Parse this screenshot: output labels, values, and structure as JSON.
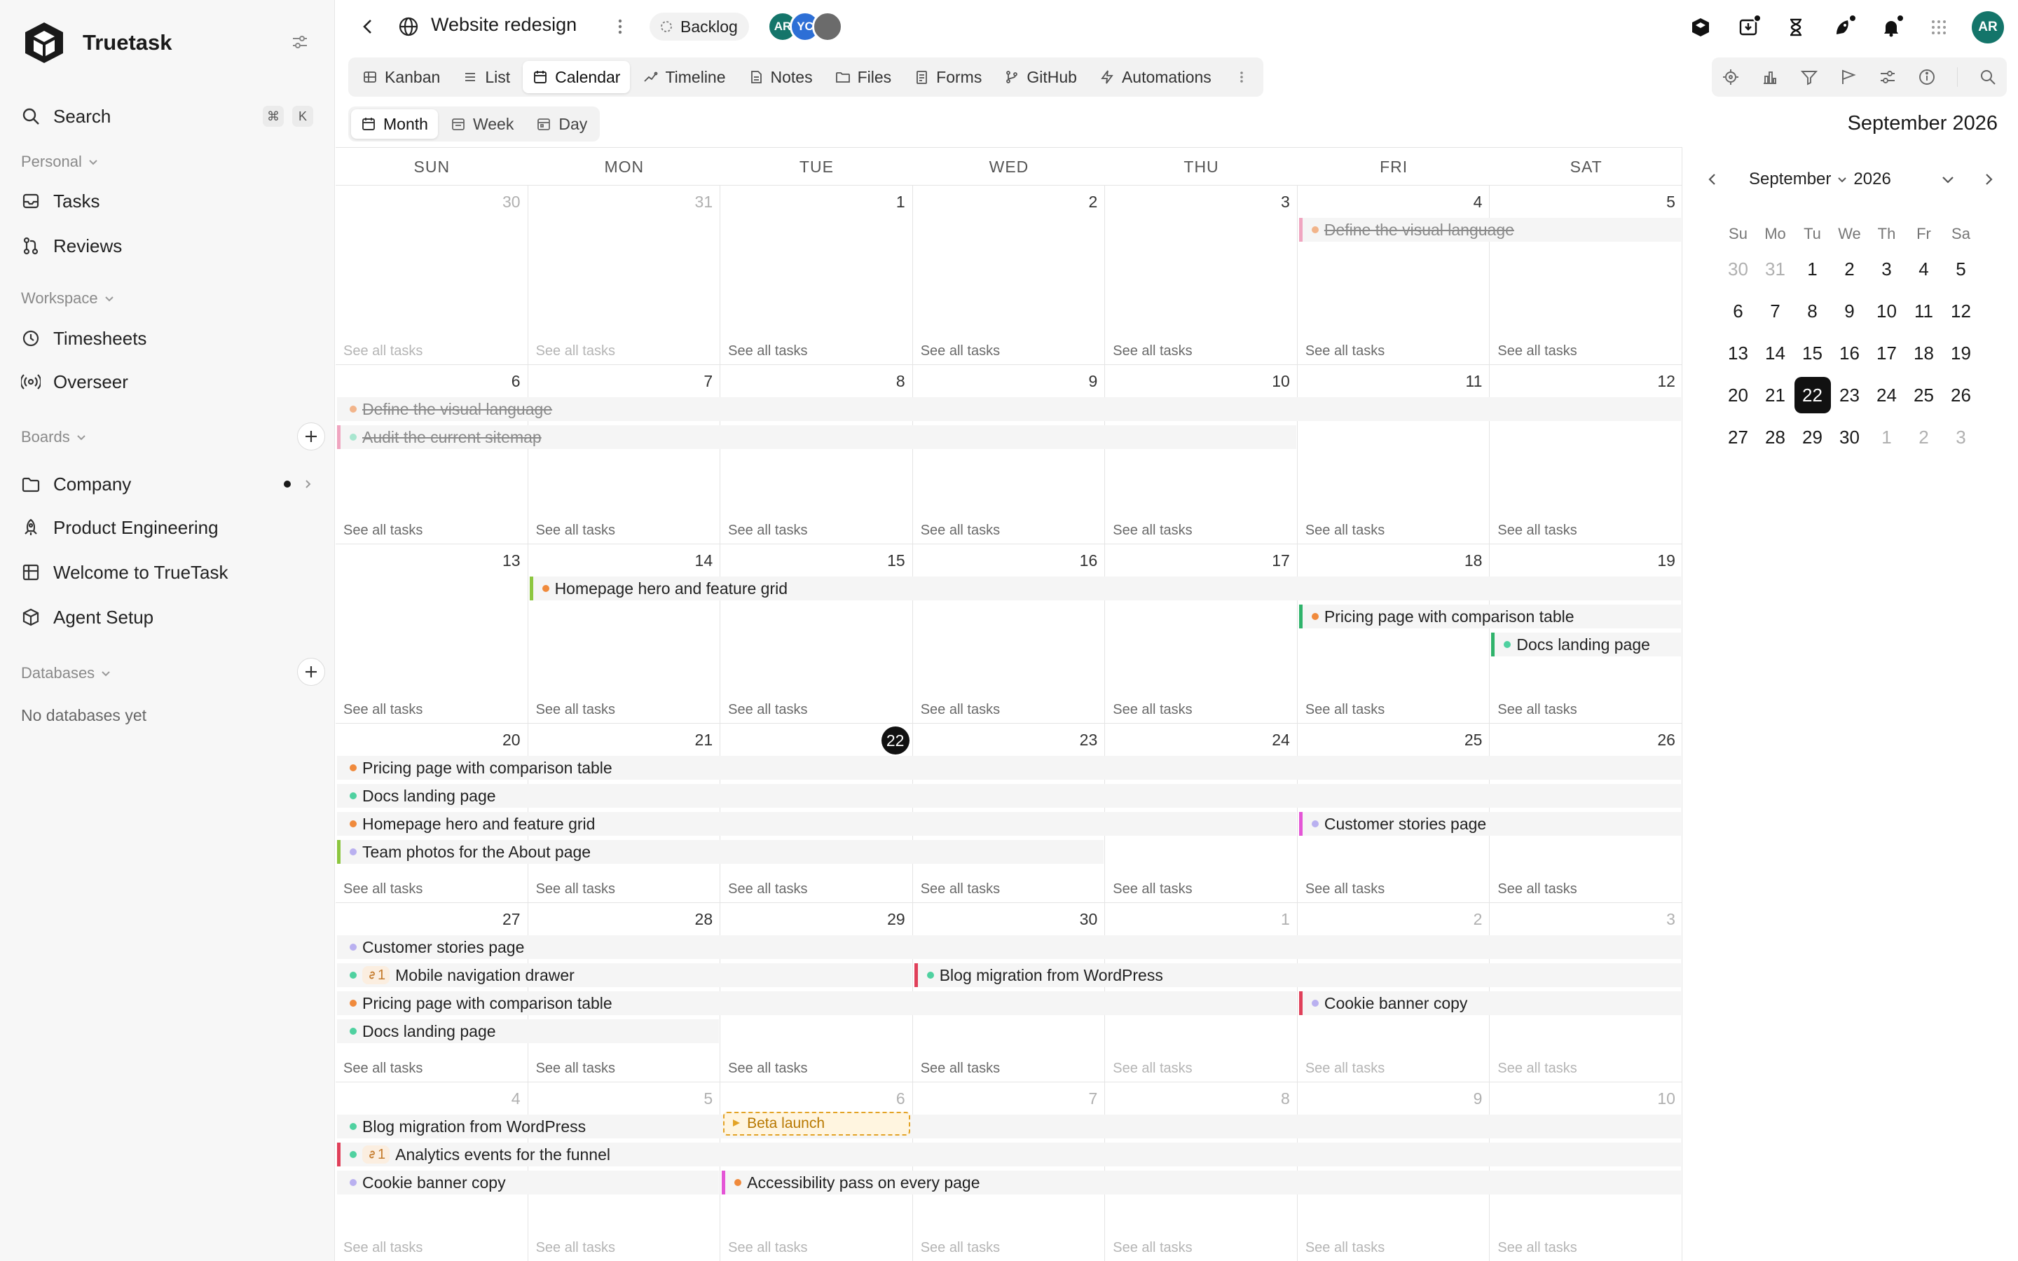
{
  "sidebar": {
    "brand": "Truetask",
    "search": {
      "label": "Search",
      "kbd1": "⌘",
      "kbd2": "K"
    },
    "personal": {
      "label": "Personal",
      "items": [
        {
          "label": "Tasks"
        },
        {
          "label": "Reviews"
        }
      ]
    },
    "workspace": {
      "label": "Workspace",
      "items": [
        {
          "label": "Timesheets"
        },
        {
          "label": "Overseer"
        }
      ]
    },
    "boards": {
      "label": "Boards",
      "items": [
        {
          "label": "Company"
        },
        {
          "label": "Product Engineering"
        },
        {
          "label": "Welcome to TrueTask"
        },
        {
          "label": "Agent Setup"
        }
      ]
    },
    "databases": {
      "label": "Databases",
      "empty": "No databases yet"
    }
  },
  "header": {
    "title": "Website redesign",
    "status": "Backlog",
    "avatars": [
      {
        "initials": "AR",
        "color": "#14756a"
      },
      {
        "initials": "YC",
        "color": "#2d6fd6"
      },
      {
        "initials": "",
        "color": "#6b6b6b"
      }
    ],
    "user_initials": "AR"
  },
  "views": [
    {
      "label": "Kanban",
      "icon": "kanban-icon",
      "active": false
    },
    {
      "label": "List",
      "icon": "list-icon",
      "active": false
    },
    {
      "label": "Calendar",
      "icon": "calendar-icon",
      "active": true
    },
    {
      "label": "Timeline",
      "icon": "timeline-icon",
      "active": false
    },
    {
      "label": "Notes",
      "icon": "notes-icon",
      "active": false
    },
    {
      "label": "Files",
      "icon": "folder-icon",
      "active": false
    },
    {
      "label": "Forms",
      "icon": "forms-icon",
      "active": false
    },
    {
      "label": "GitHub",
      "icon": "git-branch-icon",
      "active": false
    },
    {
      "label": "Automations",
      "icon": "bolt-icon",
      "active": false
    }
  ],
  "ranges": [
    {
      "label": "Month",
      "active": true
    },
    {
      "label": "Week",
      "active": false
    },
    {
      "label": "Day",
      "active": false
    }
  ],
  "calendar": {
    "title": "September 2026",
    "weekdays": [
      "SUN",
      "MON",
      "TUE",
      "WED",
      "THU",
      "FRI",
      "SAT"
    ],
    "see_all": "See all tasks",
    "weeks": [
      {
        "days": [
          {
            "n": "30",
            "m": true
          },
          {
            "n": "31",
            "m": true
          },
          {
            "n": "1"
          },
          {
            "n": "2"
          },
          {
            "n": "3"
          },
          {
            "n": "4"
          },
          {
            "n": "5"
          }
        ]
      },
      {
        "days": [
          {
            "n": "6"
          },
          {
            "n": "7"
          },
          {
            "n": "8"
          },
          {
            "n": "9"
          },
          {
            "n": "10"
          },
          {
            "n": "11"
          },
          {
            "n": "12"
          }
        ]
      },
      {
        "days": [
          {
            "n": "13"
          },
          {
            "n": "14"
          },
          {
            "n": "15"
          },
          {
            "n": "16"
          },
          {
            "n": "17"
          },
          {
            "n": "18"
          },
          {
            "n": "19"
          }
        ]
      },
      {
        "days": [
          {
            "n": "20"
          },
          {
            "n": "21"
          },
          {
            "n": "22",
            "today": true
          },
          {
            "n": "23"
          },
          {
            "n": "24"
          },
          {
            "n": "25"
          },
          {
            "n": "26"
          }
        ]
      },
      {
        "days": [
          {
            "n": "27"
          },
          {
            "n": "28"
          },
          {
            "n": "29"
          },
          {
            "n": "30"
          },
          {
            "n": "1",
            "m": true
          },
          {
            "n": "2",
            "m": true
          },
          {
            "n": "3",
            "m": true
          }
        ]
      },
      {
        "days": [
          {
            "n": "4",
            "m": true
          },
          {
            "n": "5",
            "m": true
          },
          {
            "n": "6",
            "m": true
          },
          {
            "n": "7",
            "m": true
          },
          {
            "n": "8",
            "m": true
          },
          {
            "n": "9",
            "m": true
          },
          {
            "n": "10",
            "m": true
          }
        ]
      }
    ],
    "events": [
      {
        "week": 0,
        "start": 5,
        "span": 2,
        "lane": 0,
        "title": "Define the visual language",
        "dot": "#f2b48a",
        "bar": "#f0a5c0",
        "done": true
      },
      {
        "week": 1,
        "start": 0,
        "span": 7,
        "lane": 0,
        "title": "Define the visual language",
        "dot": "#f2b48a",
        "done": true
      },
      {
        "week": 1,
        "start": 0,
        "span": 5,
        "lane": 1,
        "title": "Audit the current sitemap",
        "dot": "#a8e6cf",
        "bar": "#f0a5c0",
        "done": true
      },
      {
        "week": 2,
        "start": 1,
        "span": 6,
        "lane": 0,
        "title": "Homepage hero and feature grid",
        "dot": "#f08a3c",
        "bar": "#8cc63f"
      },
      {
        "week": 2,
        "start": 5,
        "span": 2,
        "lane": 1,
        "title": "Pricing page with comparison table",
        "dot": "#f08a3c",
        "bar": "#2fb36b"
      },
      {
        "week": 2,
        "start": 6,
        "span": 1,
        "lane": 2,
        "title": "Docs landing page",
        "dot": "#4fd1a0",
        "bar": "#2fb36b"
      },
      {
        "week": 3,
        "start": 0,
        "span": 7,
        "lane": 0,
        "title": "Pricing page with comparison table",
        "dot": "#f08a3c"
      },
      {
        "week": 3,
        "start": 0,
        "span": 7,
        "lane": 1,
        "title": "Docs landing page",
        "dot": "#4fd1a0"
      },
      {
        "week": 3,
        "start": 0,
        "span": 5,
        "lane": 2,
        "title": "Homepage hero and feature grid",
        "dot": "#f08a3c"
      },
      {
        "week": 3,
        "start": 5,
        "span": 2,
        "lane": 2,
        "title": "Customer stories page",
        "dot": "#b9b0f0",
        "bar": "#e455d6"
      },
      {
        "week": 3,
        "start": 0,
        "span": 4,
        "lane": 3,
        "title": "Team photos for the About page",
        "dot": "#b9b0f0",
        "bar": "#8cc63f"
      },
      {
        "week": 4,
        "start": 0,
        "span": 7,
        "lane": 0,
        "title": "Customer stories page",
        "dot": "#b9b0f0"
      },
      {
        "week": 4,
        "start": 0,
        "span": 3,
        "lane": 1,
        "title": "Mobile navigation drawer",
        "dot": "#4fd1a0",
        "link": "1"
      },
      {
        "week": 4,
        "start": 3,
        "span": 4,
        "lane": 1,
        "title": "Blog migration from WordPress",
        "dot": "#4fd1a0",
        "bar": "#e0405a"
      },
      {
        "week": 4,
        "start": 0,
        "span": 5,
        "lane": 2,
        "title": "Pricing page with comparison table",
        "dot": "#f08a3c"
      },
      {
        "week": 4,
        "start": 5,
        "span": 2,
        "lane": 2,
        "title": "Cookie banner copy",
        "dot": "#b9b0f0",
        "bar": "#e0405a"
      },
      {
        "week": 4,
        "start": 0,
        "span": 2,
        "lane": 3,
        "title": "Docs landing page",
        "dot": "#4fd1a0"
      },
      {
        "week": 5,
        "start": 0,
        "span": 7,
        "lane": 0,
        "title": "Blog migration from WordPress",
        "dot": "#4fd1a0"
      },
      {
        "week": 5,
        "start": 0,
        "span": 7,
        "lane": 1,
        "title": "Analytics events for the funnel",
        "dot": "#4fd1a0",
        "bar": "#e0405a",
        "link": "1"
      },
      {
        "week": 5,
        "start": 0,
        "span": 2,
        "lane": 2,
        "title": "Cookie banner copy",
        "dot": "#b9b0f0"
      },
      {
        "week": 5,
        "start": 2,
        "span": 5,
        "lane": 2,
        "title": "Accessibility pass on every page",
        "dot": "#f08a3c",
        "bar": "#e455d6"
      }
    ],
    "milestones": [
      {
        "week": 5,
        "col": 2,
        "title": "Beta launch"
      }
    ]
  },
  "mini_calendar": {
    "month": "September",
    "year": "2026",
    "weekdays": [
      "Su",
      "Mo",
      "Tu",
      "We",
      "Th",
      "Fr",
      "Sa"
    ],
    "days": [
      {
        "n": "30",
        "m": true
      },
      {
        "n": "31",
        "m": true
      },
      {
        "n": "1"
      },
      {
        "n": "2"
      },
      {
        "n": "3"
      },
      {
        "n": "4"
      },
      {
        "n": "5"
      },
      {
        "n": "6"
      },
      {
        "n": "7"
      },
      {
        "n": "8"
      },
      {
        "n": "9"
      },
      {
        "n": "10"
      },
      {
        "n": "11"
      },
      {
        "n": "12"
      },
      {
        "n": "13"
      },
      {
        "n": "14"
      },
      {
        "n": "15"
      },
      {
        "n": "16"
      },
      {
        "n": "17"
      },
      {
        "n": "18"
      },
      {
        "n": "19"
      },
      {
        "n": "20"
      },
      {
        "n": "21"
      },
      {
        "n": "22",
        "sel": true
      },
      {
        "n": "23"
      },
      {
        "n": "24"
      },
      {
        "n": "25"
      },
      {
        "n": "26"
      },
      {
        "n": "27"
      },
      {
        "n": "28"
      },
      {
        "n": "29"
      },
      {
        "n": "30"
      },
      {
        "n": "1",
        "m": true
      },
      {
        "n": "2",
        "m": true
      },
      {
        "n": "3",
        "m": true
      }
    ]
  }
}
